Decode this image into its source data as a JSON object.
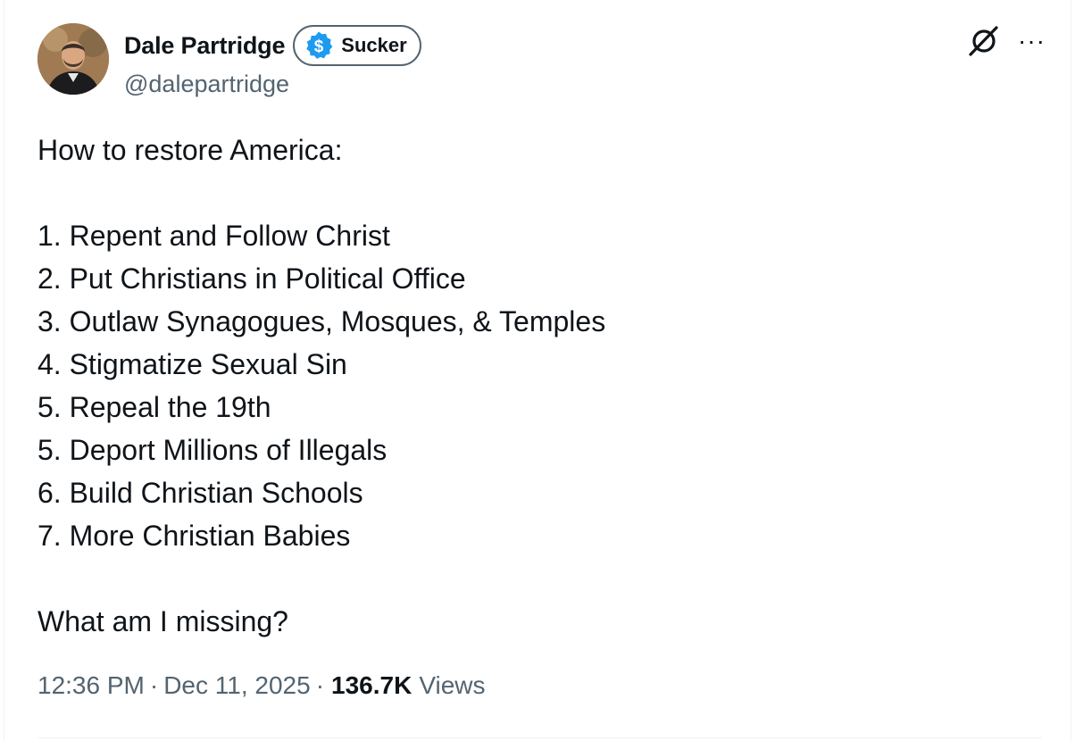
{
  "author": {
    "display_name": "Dale Partridge",
    "handle": "@dalepartridge",
    "badge_label": "Sucker",
    "badge_icon": "dollar-sign-badge-icon",
    "badge_color": "#1d9bf0"
  },
  "tweet": {
    "lines": [
      "How to restore America:",
      "",
      "1. Repent and Follow Christ",
      "2. Put Christians in Political Office",
      "3. Outlaw Synagogues, Mosques, & Temples",
      "4. Stigmatize Sexual Sin",
      "5. Repeal the 19th",
      "5. Deport Millions of Illegals",
      "6. Build Christian Schools",
      "7. More Christian Babies",
      "",
      "What am I missing?"
    ]
  },
  "meta": {
    "time": "12:36 PM",
    "separator": "·",
    "date": "Dec 11, 2025",
    "views_count": "136.7K",
    "views_label": "Views"
  },
  "icons": {
    "grok": "grok-icon",
    "more": "more-options-icon",
    "more_glyph": "···"
  },
  "colors": {
    "text_primary": "#0f1419",
    "text_secondary": "#536471",
    "accent": "#1d9bf0"
  }
}
